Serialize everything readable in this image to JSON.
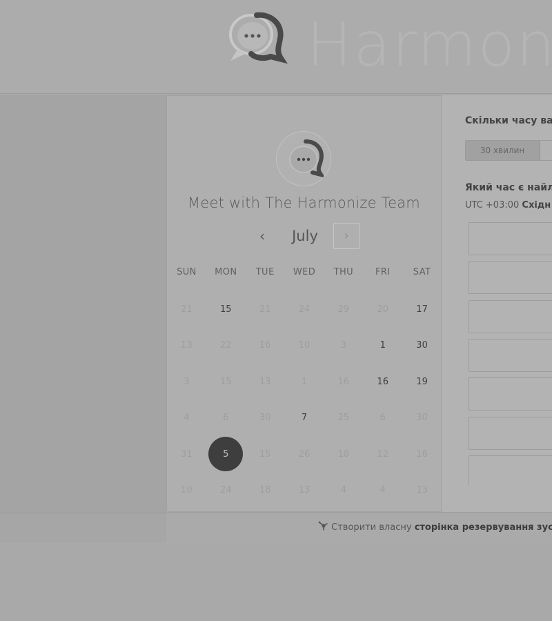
{
  "brand": {
    "name": "Harmon",
    "logo_icon": "chat-bubble-dots-icon"
  },
  "meeting": {
    "avatar_icon": "chat-bubble-dots-icon",
    "title": "Meet with The Harmonize Team"
  },
  "calendar": {
    "prev_icon": "‹",
    "next_icon": "›",
    "month": "July",
    "weekdays": [
      "SUN",
      "MON",
      "TUE",
      "WED",
      "THU",
      "FRI",
      "SAT"
    ],
    "weeks": [
      [
        {
          "d": "21",
          "a": false
        },
        {
          "d": "15",
          "a": true
        },
        {
          "d": "21",
          "a": false
        },
        {
          "d": "24",
          "a": false
        },
        {
          "d": "29",
          "a": false
        },
        {
          "d": "20",
          "a": false
        },
        {
          "d": "17",
          "a": true
        }
      ],
      [
        {
          "d": "13",
          "a": false
        },
        {
          "d": "22",
          "a": false
        },
        {
          "d": "16",
          "a": false
        },
        {
          "d": "10",
          "a": false
        },
        {
          "d": "3",
          "a": false
        },
        {
          "d": "1",
          "a": true
        },
        {
          "d": "30",
          "a": true
        }
      ],
      [
        {
          "d": "3",
          "a": false
        },
        {
          "d": "15",
          "a": false
        },
        {
          "d": "13",
          "a": false
        },
        {
          "d": "1",
          "a": false
        },
        {
          "d": "16",
          "a": false
        },
        {
          "d": "16",
          "a": true
        },
        {
          "d": "19",
          "a": true
        }
      ],
      [
        {
          "d": "4",
          "a": false
        },
        {
          "d": "6",
          "a": false
        },
        {
          "d": "30",
          "a": false
        },
        {
          "d": "7",
          "a": true
        },
        {
          "d": "25",
          "a": false
        },
        {
          "d": "6",
          "a": false
        },
        {
          "d": "30",
          "a": false
        }
      ],
      [
        {
          "d": "31",
          "a": false
        },
        {
          "d": "5",
          "a": true,
          "s": true
        },
        {
          "d": "15",
          "a": false
        },
        {
          "d": "26",
          "a": false
        },
        {
          "d": "18",
          "a": false
        },
        {
          "d": "12",
          "a": false
        },
        {
          "d": "16",
          "a": false
        }
      ],
      [
        {
          "d": "10",
          "a": false
        },
        {
          "d": "24",
          "a": false
        },
        {
          "d": "18",
          "a": false
        },
        {
          "d": "13",
          "a": false
        },
        {
          "d": "4",
          "a": false
        },
        {
          "d": "4",
          "a": false
        },
        {
          "d": "13",
          "a": false
        }
      ]
    ]
  },
  "booking": {
    "duration_heading": "Скільки часу ва",
    "duration_option": "30 хвилин",
    "time_heading": "Який час є найл",
    "timezone_prefix": "UTC +03:00",
    "timezone_name": "Східн",
    "slot_count": 7
  },
  "footer": {
    "icon": "sprocket-icon",
    "text_prefix": "Створити власну",
    "text_bold": "сторінка резервування зустрі"
  }
}
